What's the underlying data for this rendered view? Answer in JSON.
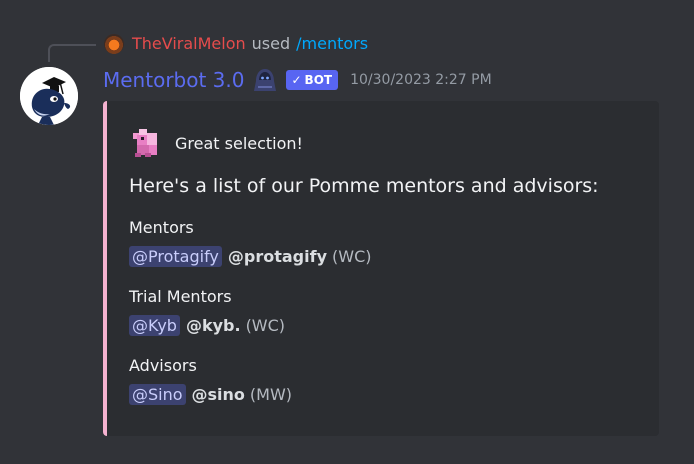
{
  "reply": {
    "username": "TheViralMelon",
    "used_text": "used",
    "command": "/mentors"
  },
  "message": {
    "author": "Mentorbot 3.0",
    "bot_tag": "BOT",
    "timestamp": "10/30/2023 2:27 PM"
  },
  "embed": {
    "accent_color": "#f5b2d0",
    "author_name": "Great selection!",
    "title": "Here's a list of our Pomme mentors and advisors:",
    "fields": [
      {
        "name": "Mentors",
        "mention": "@Protagify",
        "handle": "@protagify",
        "region": "(WC)"
      },
      {
        "name": "Trial Mentors",
        "mention": "@Kyb",
        "handle": "@kyb.",
        "region": "(WC)"
      },
      {
        "name": "Advisors",
        "mention": "@Sino",
        "handle": "@sino",
        "region": "(MW)"
      }
    ]
  },
  "colors": {
    "background": "#313338",
    "embed_background": "#2b2d31",
    "author_name": "#5b6cf0",
    "reply_username": "#e64c4c",
    "command_link": "#00a8fc",
    "bot_tag": "#5865f2",
    "mention_background": "#3c4270"
  }
}
